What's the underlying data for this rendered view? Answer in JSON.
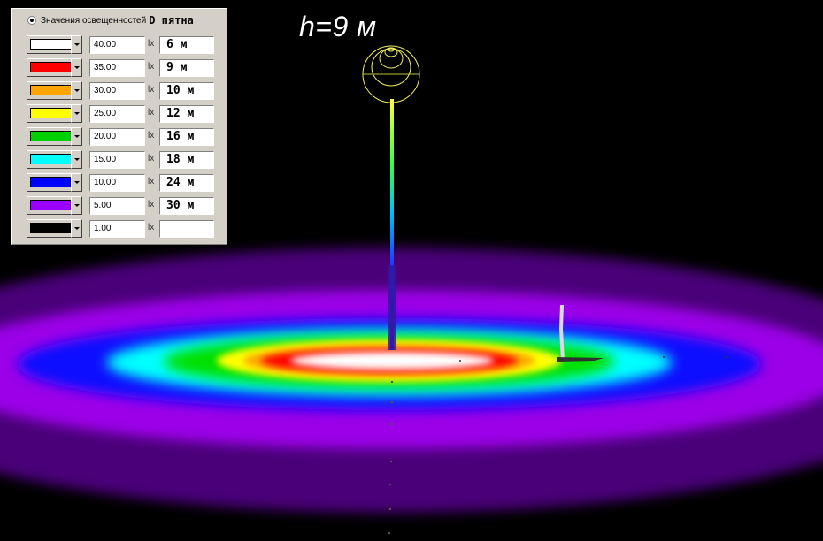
{
  "height_label": "h=9 м",
  "legend": {
    "header_title": "Значения освещенностей",
    "header_extra": "D пятна",
    "unit": "lx",
    "rows": [
      {
        "color": "#ffffff",
        "value": "40.00",
        "diameter": "6 м"
      },
      {
        "color": "#ff0000",
        "value": "35.00",
        "diameter": "9 м"
      },
      {
        "color": "#ffa500",
        "value": "30.00",
        "diameter": "10 м"
      },
      {
        "color": "#ffff00",
        "value": "25.00",
        "diameter": "12 м"
      },
      {
        "color": "#00d000",
        "value": "20.00",
        "diameter": "16 м"
      },
      {
        "color": "#00ffff",
        "value": "15.00",
        "diameter": "18 м"
      },
      {
        "color": "#0000ff",
        "value": "10.00",
        "diameter": "24 м"
      },
      {
        "color": "#9900ff",
        "value": "5.00",
        "diameter": "30 м"
      },
      {
        "color": "#000000",
        "value": "1.00",
        "diameter": ""
      }
    ]
  }
}
